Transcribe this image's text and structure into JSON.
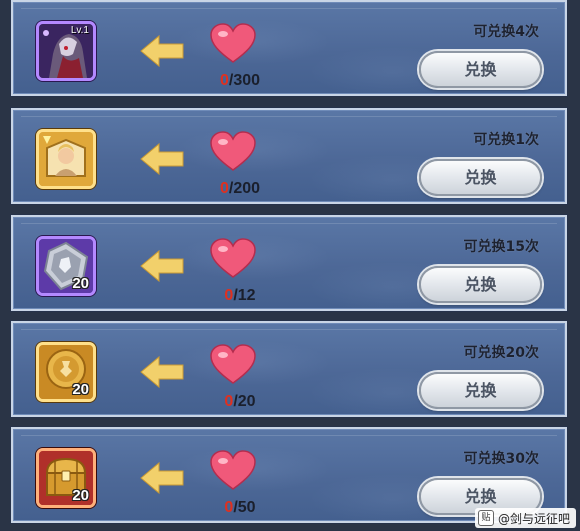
{
  "exchange_rows": [
    {
      "item": "hero-card",
      "item_level": "Lv.1",
      "item_qty": "",
      "cost_have": "0",
      "cost_need": "/300",
      "limit": "可兑换4次",
      "button": "兑换"
    },
    {
      "item": "portrait-chest",
      "item_level": "",
      "item_qty": "",
      "cost_have": "0",
      "cost_need": "/200",
      "limit": "可兑换1次",
      "button": "兑换"
    },
    {
      "item": "silver-coin",
      "item_level": "",
      "item_qty": "20",
      "cost_have": "0",
      "cost_need": "/12",
      "limit": "可兑换15次",
      "button": "兑换"
    },
    {
      "item": "gold-coin",
      "item_level": "",
      "item_qty": "20",
      "cost_have": "0",
      "cost_need": "/20",
      "limit": "可兑换20次",
      "button": "兑换"
    },
    {
      "item": "treasure-chest",
      "item_level": "",
      "item_qty": "20",
      "cost_have": "0",
      "cost_need": "/50",
      "limit": "可兑换30次",
      "button": "兑换"
    }
  ],
  "watermark": {
    "icon_text": "贴",
    "text": "@剑与远征吧"
  },
  "colors": {
    "panel": "#4d6897",
    "cost_red": "#e0301f",
    "heart": "#f0597a",
    "arrow": "#f2d06b"
  }
}
